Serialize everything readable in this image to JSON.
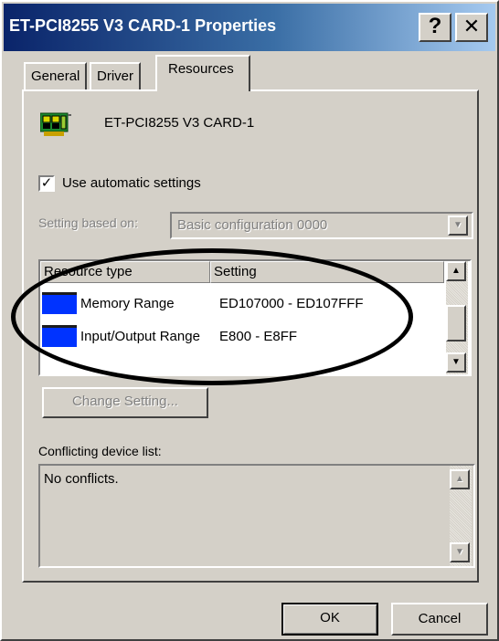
{
  "window": {
    "title": "ET-PCI8255 V3 CARD-1 Properties",
    "help_glyph": "?",
    "close_glyph": "✕"
  },
  "tabs": [
    {
      "label": "General",
      "active": false
    },
    {
      "label": "Driver",
      "active": false
    },
    {
      "label": "Resources",
      "active": true
    }
  ],
  "device": {
    "icon": "pci-card-icon",
    "name": "ET-PCI8255 V3 CARD-1"
  },
  "auto_settings": {
    "label": "Use automatic settings",
    "checked": true,
    "check_glyph": "✓"
  },
  "setting_based_on": {
    "label": "Setting based on:",
    "value": "Basic configuration 0000"
  },
  "resources_table": {
    "headers": [
      "Resource type",
      "Setting"
    ],
    "rows": [
      {
        "type": "Memory Range",
        "setting": "ED107000 - ED107FFF"
      },
      {
        "type": "Input/Output Range",
        "setting": "E800 - E8FF"
      }
    ]
  },
  "change_setting_button": "Change Setting...",
  "conflicts": {
    "label": "Conflicting device list:",
    "text": "No conflicts."
  },
  "footer": {
    "ok": "OK",
    "cancel": "Cancel"
  },
  "colors": {
    "titlebar_start": "#0a246a",
    "titlebar_end": "#a6caf0",
    "face": "#d4d0c8",
    "resource_icon": "#0033ff"
  }
}
